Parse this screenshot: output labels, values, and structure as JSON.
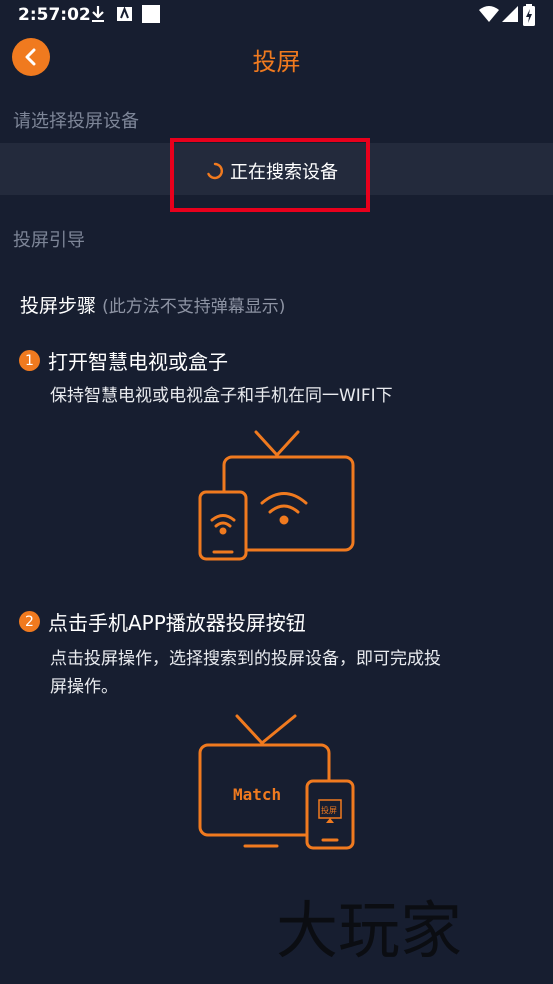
{
  "status_bar": {
    "time": "2:57:02"
  },
  "header": {
    "title": "投屏"
  },
  "select_label": "请选择投屏设备",
  "device_search": {
    "text": "正在搜索设备"
  },
  "guide_label": "投屏引导",
  "steps": {
    "title": "投屏步骤",
    "note": "(此方法不支持弹幕显示)",
    "step1": {
      "number": "1",
      "title": "打开智慧电视或盒子",
      "desc": "保持智慧电视或电视盒子和手机在同一WIFI下"
    },
    "step2": {
      "number": "2",
      "title": "点击手机APP播放器投屏按钮",
      "desc_line1": "点击投屏操作，选择搜索到的投屏设备，即可完成投",
      "desc_line2": "屏操作。"
    }
  },
  "illustration2": {
    "tv_text": "Match",
    "phone_text": "投屏"
  },
  "watermark": "大玩家",
  "colors": {
    "accent": "#f07a1f",
    "background": "#171e30",
    "highlight": "#e8001c"
  }
}
